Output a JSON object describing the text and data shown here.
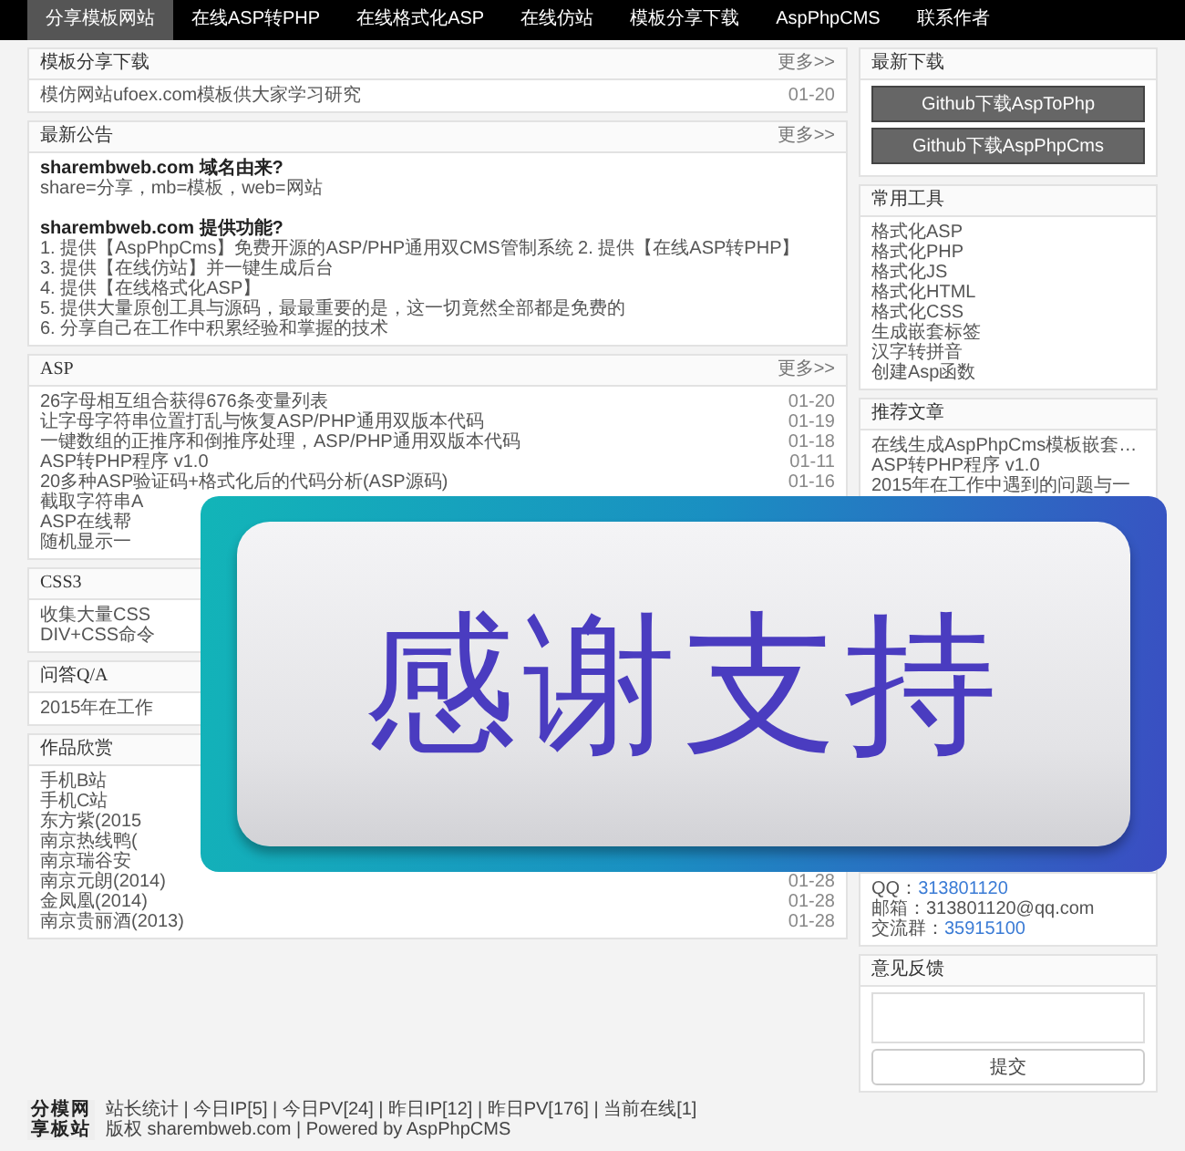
{
  "nav": [
    {
      "label": "分享模板网站",
      "selected": true
    },
    {
      "label": "在线ASP转PHP",
      "selected": false
    },
    {
      "label": "在线格式化ASP",
      "selected": false
    },
    {
      "label": "在线仿站",
      "selected": false
    },
    {
      "label": "模板分享下载",
      "selected": false
    },
    {
      "label": "AspPhpCMS",
      "selected": false
    },
    {
      "label": "联系作者",
      "selected": false
    }
  ],
  "left": [
    {
      "kind": "list",
      "title": "模板分享下载",
      "more": "更多>>",
      "rows": [
        {
          "text": "模仿网站ufoex.com模板供大家学习研究",
          "date": "01-20"
        }
      ]
    },
    {
      "kind": "notice",
      "title": "最新公告",
      "more": "更多>>",
      "lines": [
        {
          "kind": "heading",
          "text": "sharembweb.com 域名由来?"
        },
        {
          "kind": "line",
          "text": "share=分享，mb=模板，web=网站"
        },
        {
          "kind": "heading",
          "text": "sharembweb.com 提供功能?"
        },
        {
          "kind": "line",
          "text": "1. 提供【AspPhpCms】免费开源的ASP/PHP通用双CMS管制系统 2. 提供【在线ASP转PHP】"
        },
        {
          "kind": "line",
          "text": "3. 提供【在线仿站】并一键生成后台"
        },
        {
          "kind": "line",
          "text": "4. 提供【在线格式化ASP】"
        },
        {
          "kind": "line",
          "text": "5. 提供大量原创工具与源码，最最重要的是，这一切竟然全部都是免费的"
        },
        {
          "kind": "line",
          "text": "6. 分享自己在工作中积累经验和掌握的技术"
        }
      ]
    },
    {
      "kind": "list",
      "title": "ASP",
      "more": "更多>>",
      "rows": [
        {
          "text": "26字母相互组合获得676条变量列表",
          "date": "01-20"
        },
        {
          "text": "让字母字符串位置打乱与恢复ASP/PHP通用双版本代码",
          "date": "01-19"
        },
        {
          "text": "一键数组的正推序和倒推序处理，ASP/PHP通用双版本代码",
          "date": "01-18"
        },
        {
          "text": "ASP转PHP程序 v1.0",
          "date": "01-11"
        },
        {
          "text": "20多种ASP验证码+格式化后的代码分析(ASP源码)",
          "date": "01-16"
        },
        {
          "text": "截取字符串A"
        },
        {
          "text": "ASP在线帮"
        },
        {
          "text": "随机显示一"
        }
      ]
    },
    {
      "kind": "list",
      "title": "CSS3",
      "rows": [
        {
          "text": "收集大量CSS"
        },
        {
          "text": "DIV+CSS命令"
        }
      ]
    },
    {
      "kind": "list",
      "title": "问答Q/A",
      "rows": [
        {
          "text": "2015年在工作"
        }
      ]
    },
    {
      "kind": "list",
      "title": "作品欣赏",
      "rows": [
        {
          "text": "手机B站"
        },
        {
          "text": "手机C站"
        },
        {
          "text": "东方紫(2015"
        },
        {
          "text": "南京热线鸭("
        },
        {
          "text": "南京瑞谷安"
        },
        {
          "text": "南京元朗(2014)",
          "date": "01-28"
        },
        {
          "text": "金凤凰(2014)",
          "date": "01-28"
        },
        {
          "text": "南京贵丽酒(2013)",
          "date": "01-28"
        }
      ]
    }
  ],
  "right": [
    {
      "kind": "buttons",
      "title": "最新下载",
      "buttons": [
        "Github下载AspToPhp",
        "Github下载AspPhpCms"
      ]
    },
    {
      "kind": "links",
      "title": "常用工具",
      "links": [
        "格式化ASP",
        "格式化PHP",
        "格式化JS",
        "格式化HTML",
        "格式化CSS",
        "生成嵌套标签",
        "汉字转拼音",
        "创建Asp函数"
      ]
    },
    {
      "kind": "articles",
      "title": "推荐文章",
      "links": [
        "在线生成AspPhpCms模板嵌套…",
        "ASP转PHP程序 v1.0",
        "2015年在工作中遇到的问题与一"
      ]
    },
    {
      "kind": "contact",
      "rows": [
        {
          "label": "QQ：",
          "value": "313801120",
          "link": true
        },
        {
          "label": "邮箱：",
          "value": "313801120@qq.com",
          "link": false
        },
        {
          "label": "交流群：",
          "value": "35915100",
          "link": true
        }
      ]
    },
    {
      "kind": "feedback",
      "title": "意见反馈",
      "submit": "提交"
    }
  ],
  "banner": {
    "text": "感谢支持"
  },
  "footer": {
    "logo": [
      "分模网",
      "享板站"
    ],
    "stats": "站长统计 | 今日IP[5] | 今日PV[24] | 昨日IP[12] | 昨日PV[176] | 当前在线[1]",
    "copyright": "版权 sharembweb.com | Powered by AspPhpCMS"
  }
}
